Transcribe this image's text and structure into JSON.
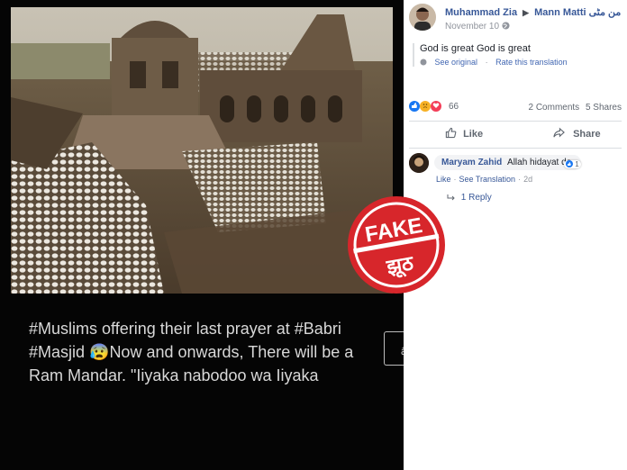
{
  "post_image": {
    "caption_lines": [
      "#Muslims offering their last prayer at #Babri",
      "#Masjid 😰Now and onwards, There will be a",
      "Ram Mandar. \"Iiyaka nabodoo wa Iiyaka"
    ],
    "edge_button_glyph": "â"
  },
  "stamp": {
    "top_text": "FAKE",
    "bottom_text": "झूठ",
    "color": "#d7262b"
  },
  "header": {
    "author": "Muhammad Zia",
    "arrow": "▶",
    "group": "Mann Matti من مٹی",
    "date": "November 10",
    "privacy_icon": "globe-icon"
  },
  "post": {
    "text": "God is great God is great",
    "links": [
      "See original",
      "Rate this translation"
    ]
  },
  "reactions": {
    "icons": [
      "like-icon",
      "sad-icon",
      "love-icon"
    ],
    "count": "66",
    "comments": "2 Comments",
    "shares": "5 Shares"
  },
  "actions": {
    "like": "Like",
    "share": "Share"
  },
  "comment": {
    "author": "Maryam Zahid",
    "text": "Allah hidayat de.",
    "reaction_count": "1",
    "links": [
      "Like",
      "See Translation"
    ],
    "time": "2d",
    "replies": "1 Reply"
  },
  "colors": {
    "link": "#385898",
    "like_blue": "#1877f2",
    "sad_yellow": "#f7b125",
    "love_red": "#f33e58"
  }
}
